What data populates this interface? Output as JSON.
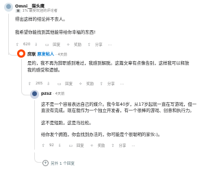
{
  "c1": {
    "username": "Omni__猫头鹰",
    "flair": "1% 最受欢迎的评论者",
    "line1": "得出这样的结论并不丧人。",
    "line2": "我希望你能找到其他能带给你幸福的东西!",
    "votes": "620",
    "reply": "回复",
    "award": "奖励",
    "share": "分享",
    "more": "…"
  },
  "c2": {
    "username": "庶联",
    "op_tag": "原发帖人",
    "time": "· 4天前",
    "line1": "是的，我不再为辞职感到难过，我感到解脱。这篇文章有点像告别，这样我可以释放",
    "line2": "我的感受和遗憾。",
    "votes": "265",
    "reply": "回复",
    "award": "奖励",
    "share": "分享",
    "more": "…"
  },
  "c3": {
    "username": "pzsz",
    "time": "· 4天前",
    "line1": "这不是一个容易表达自己的媒介。我今年40岁，从17岁起就一直在写游戏，但一",
    "line2": "直没有完成。现在我作为一个独立开发者，有一个很棒的游戏、创意和执行力。",
    "line3": "这不是短跑，这是马拉松。",
    "line4": "给你发个拥抱，你会找到办法的，你可能是个很聪明的家伙:)。",
    "votes": "92",
    "reply": "回复",
    "award": "奖励",
    "share": "分享",
    "more": "…"
  },
  "more_replies": "另外 1 个回复"
}
